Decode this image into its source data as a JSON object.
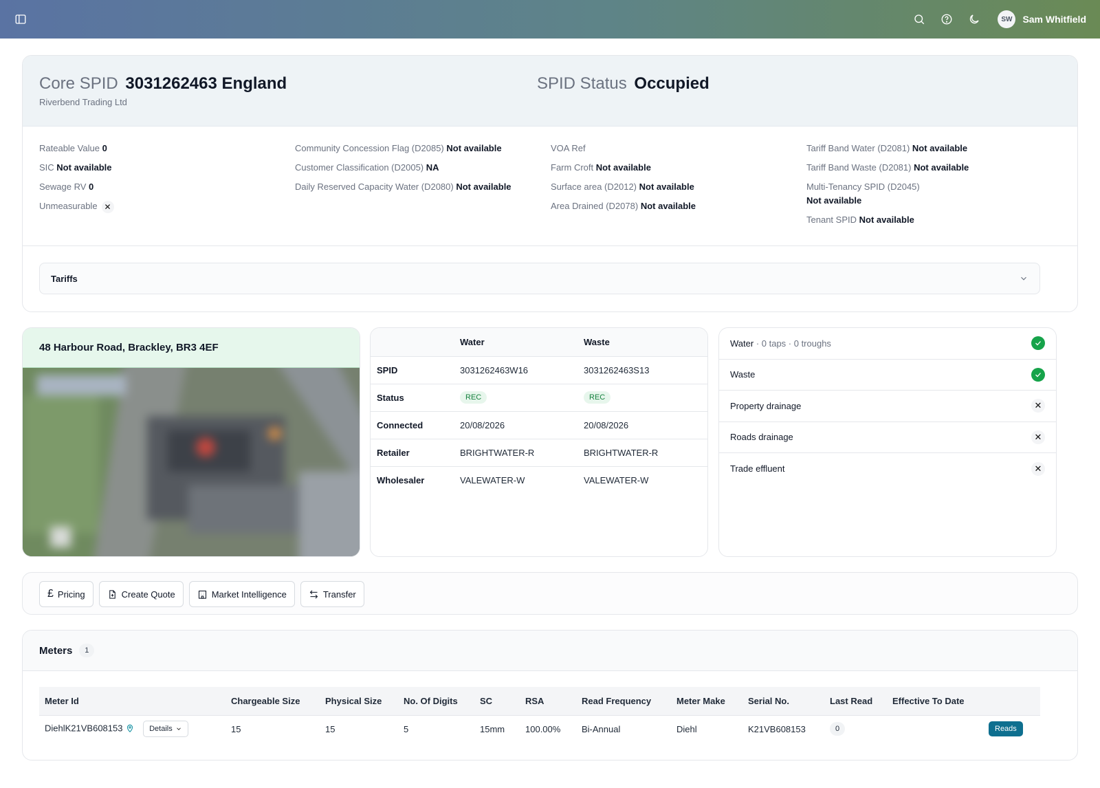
{
  "user": {
    "initials": "SW",
    "name": "Sam Whitfield"
  },
  "core": {
    "label": "Core SPID",
    "value": "3031262463 England",
    "company": "Riverbend Trading Ltd",
    "status_label": "SPID Status",
    "status_value": "Occupied"
  },
  "attributes": {
    "col1": [
      {
        "label": "Rateable Value",
        "value": "0"
      },
      {
        "label": "SIC",
        "value": "Not available"
      },
      {
        "label": "Sewage RV",
        "value": "0"
      },
      {
        "label": "Unmeasurable",
        "value": "✕"
      }
    ],
    "col2": [
      {
        "label": "Community Concession Flag (D2085)",
        "value": "Not available"
      },
      {
        "label": "Customer Classification (D2005)",
        "value": "NA"
      },
      {
        "label": "Daily Reserved Capacity Water (D2080)",
        "value": "Not available"
      }
    ],
    "col3": [
      {
        "label": "VOA Ref",
        "value": ""
      },
      {
        "label": "Farm Croft",
        "value": "Not available"
      },
      {
        "label": "Surface area (D2012)",
        "value": "Not available"
      },
      {
        "label": "Area Drained (D2078)",
        "value": "Not available"
      }
    ],
    "col4": [
      {
        "label": "Tariff Band Water (D2081)",
        "value": "Not available"
      },
      {
        "label": "Tariff Band Waste (D2081)",
        "value": "Not available"
      },
      {
        "label": "Multi-Tenancy SPID (D2045)",
        "value": "Not available"
      },
      {
        "label": "Tenant SPID",
        "value": "Not available"
      }
    ]
  },
  "tariffs": {
    "label": "Tariffs"
  },
  "address": "48 Harbour Road, Brackley, BR3 4EF",
  "spid_table": {
    "headers": [
      "Water",
      "Waste"
    ],
    "rows": [
      {
        "label": "SPID",
        "water": "3031262463W16",
        "waste": "3031262463S13"
      },
      {
        "label": "Status",
        "water": "REC",
        "waste": "REC"
      },
      {
        "label": "Connected",
        "water": "20/08/2026",
        "waste": "20/08/2026"
      },
      {
        "label": "Retailer",
        "water": "BRIGHTWATER-R",
        "waste": "BRIGHTWATER-R"
      },
      {
        "label": "Wholesaler",
        "water": "VALEWATER-W",
        "waste": "VALEWATER-W"
      }
    ]
  },
  "services": {
    "water_label": "Water",
    "water_detail": " · 0 taps · 0 troughs",
    "items": [
      {
        "label": "Waste",
        "state": "yes"
      },
      {
        "label": "Property drainage",
        "state": "no"
      },
      {
        "label": "Roads drainage",
        "state": "no"
      },
      {
        "label": "Trade effluent",
        "state": "no"
      }
    ]
  },
  "actions": {
    "pricing": "Pricing",
    "create_quote": "Create Quote",
    "market_intelligence": "Market Intelligence",
    "transfer": "Transfer"
  },
  "meters": {
    "title": "Meters",
    "count": "1",
    "columns": [
      "Meter Id",
      "Chargeable Size",
      "Physical Size",
      "No. Of Digits",
      "SC",
      "RSA",
      "Read Frequency",
      "Meter Make",
      "Serial No.",
      "Last Read",
      "Effective To Date"
    ],
    "row": {
      "meter_id": "DiehlK21VB608153",
      "details_label": "Details",
      "chargeable_size": "15",
      "physical_size": "15",
      "digits": "5",
      "sc": "15mm",
      "rsa": "100.00%",
      "read_frequency": "Bi-Annual",
      "meter_make": "Diehl",
      "serial_no": "K21VB608153",
      "last_read": "0",
      "effective_to_date": "",
      "reads_label": "Reads"
    }
  }
}
